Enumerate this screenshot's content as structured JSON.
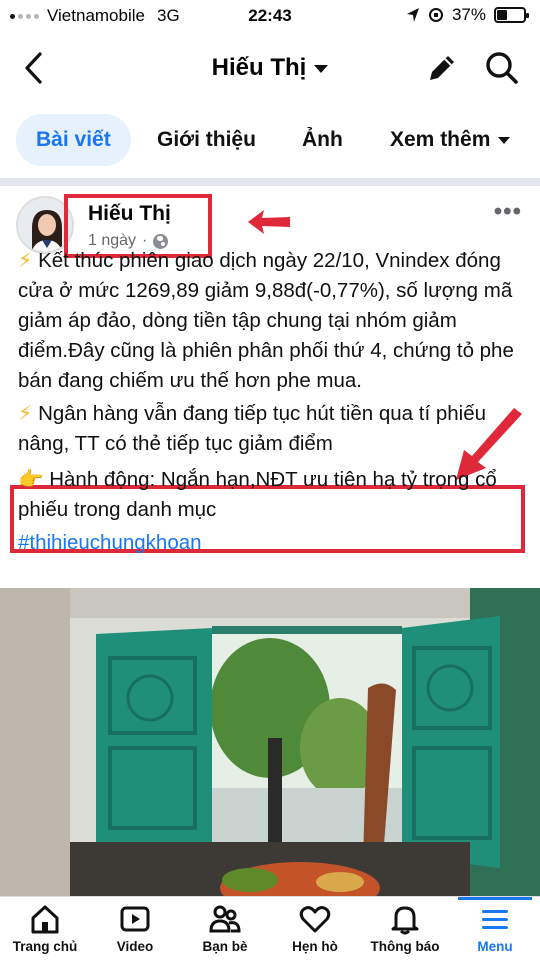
{
  "status_bar": {
    "carrier": "Vietnamobile",
    "network": "3G",
    "time": "22:43",
    "battery": "37%"
  },
  "header": {
    "title": "Hiếu Thị",
    "back_icon": "chevron-left-icon",
    "edit_icon": "pencil-icon",
    "search_icon": "search-icon"
  },
  "tabs": [
    {
      "label": "Bài viết",
      "active": true
    },
    {
      "label": "Giới thiệu"
    },
    {
      "label": "Ảnh"
    },
    {
      "label": "Xem thêm"
    }
  ],
  "post": {
    "author": "Hiếu Thị",
    "time": "1 ngày",
    "separator": "·",
    "more_label": "•••",
    "paragraphs": [
      {
        "icon": "⚡",
        "text": " Kết thúc phiên giao dịch ngày 22/10, Vnindex đóng cửa ở mức 1269,89 giảm 9,88đ(-0,77%), số lượng mã giảm áp đảo, dòng tiền tập chung tại nhóm giảm điểm.Đây cũng là phiên phân phối thứ 4, chứng tỏ phe bán đang chiếm ưu thế hơn phe mua."
      },
      {
        "icon": "⚡",
        "text": " Ngân hàng vẫn đang tiếp tục hút tiền qua tí phiếu nâng, TT có thẻ tiếp tục giảm điểm"
      },
      {
        "icon": "👉",
        "text": " Hành động: Ngắn hạn,NĐT ưu tiên hạ tỷ trọng cổ phiếu trong danh mục"
      }
    ],
    "hashtag": "#thihieuchungkhoan"
  },
  "colors": {
    "accent": "#1877f2",
    "annotation_red": "#e0283b",
    "door_green": "#1f8f7a"
  },
  "bottom_nav": [
    {
      "label": "Trang chủ",
      "icon": "home-icon"
    },
    {
      "label": "Video",
      "icon": "video-icon"
    },
    {
      "label": "Bạn bè",
      "icon": "friends-icon"
    },
    {
      "label": "Hẹn hò",
      "icon": "heart-icon"
    },
    {
      "label": "Thông báo",
      "icon": "bell-icon"
    },
    {
      "label": "Menu",
      "icon": "menu-icon",
      "active": true
    }
  ]
}
